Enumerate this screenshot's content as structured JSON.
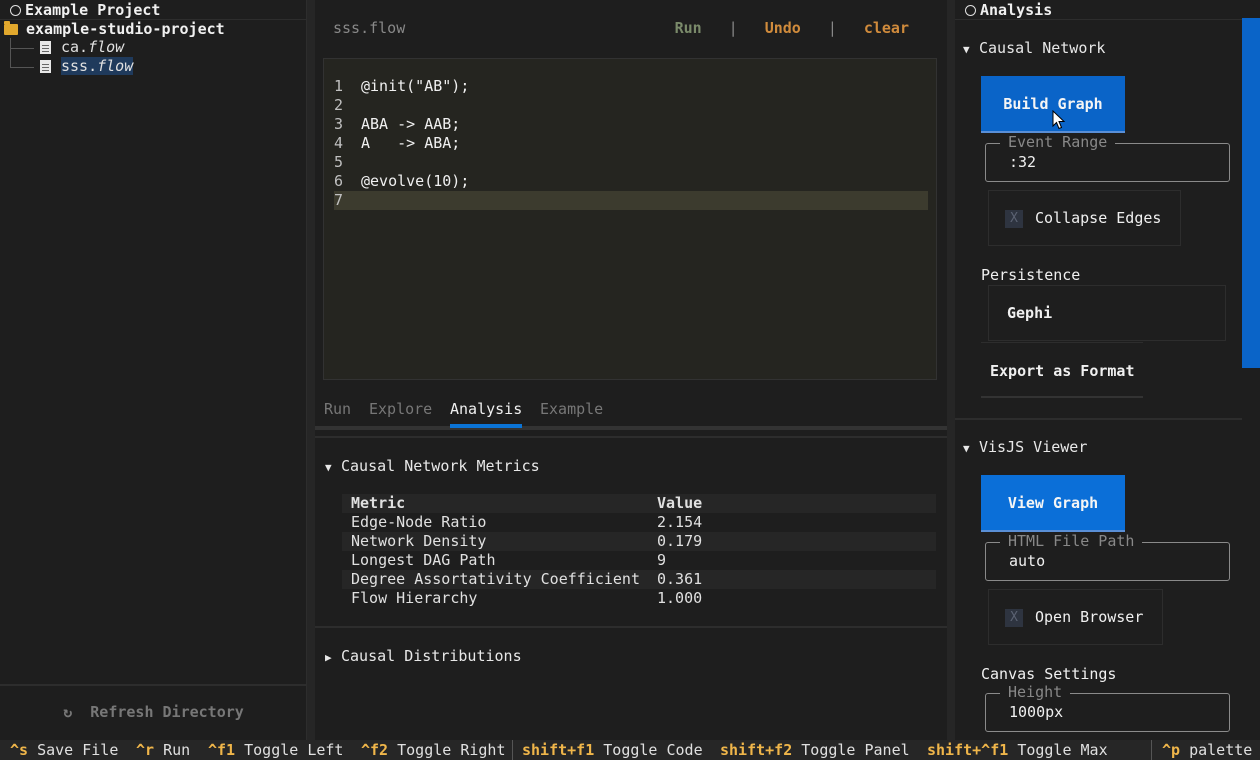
{
  "left_panel": {
    "title": "Example Project",
    "root_folder": "example-studio-project",
    "files": [
      {
        "name": "ca.",
        "ext": "flow"
      },
      {
        "name": "sss.",
        "ext": "flow"
      }
    ],
    "refresh_label": "Refresh Directory",
    "refresh_icon": "↻"
  },
  "editor": {
    "file_title": "sss.flow",
    "actions": {
      "run": "Run",
      "undo": "Undo",
      "clear": "clear",
      "sep": "|"
    },
    "lines": [
      {
        "n": "1",
        "text": "@init(\"AB\");"
      },
      {
        "n": "2",
        "text": ""
      },
      {
        "n": "3",
        "text": "ABA -> AAB;"
      },
      {
        "n": "4",
        "text": "A   -> ABA;"
      },
      {
        "n": "5",
        "text": ""
      },
      {
        "n": "6",
        "text": "@evolve(10);"
      },
      {
        "n": "7",
        "text": ""
      }
    ]
  },
  "bottom_tabs": [
    "Run",
    "Explore",
    "Analysis",
    "Example"
  ],
  "metrics": {
    "section_title": "Causal Network Metrics",
    "headers": [
      "Metric",
      "Value"
    ],
    "rows": [
      [
        "Edge-Node Ratio",
        "2.154"
      ],
      [
        "Network Density",
        "0.179"
      ],
      [
        "Longest DAG Path",
        "9"
      ],
      [
        "Degree Assortativity Coefficient",
        "0.361"
      ],
      [
        "Flow Hierarchy",
        "1.000"
      ]
    ],
    "distributions_title": "Causal Distributions"
  },
  "right_panel": {
    "title": "Analysis",
    "causal_network": {
      "title": "Causal Network",
      "build_button": "Build Graph",
      "event_range_legend": "Event Range",
      "event_range_value": ":32",
      "collapse_edges_label": "Collapse Edges",
      "collapse_checkbox": "X",
      "persistence_label": "Persistence",
      "persistence_value": "Gephi",
      "export_button": "Export as Format"
    },
    "visjs": {
      "title": "VisJS Viewer",
      "view_button": "View Graph",
      "html_path_legend": "HTML File Path",
      "html_path_value": "auto",
      "open_browser_label": "Open Browser",
      "open_browser_checkbox": "X",
      "canvas_settings_label": "Canvas Settings",
      "height_legend": "Height",
      "height_value": "1000px"
    }
  },
  "footer": [
    {
      "key": "^s",
      "desc": "Save File"
    },
    {
      "key": "^r",
      "desc": "Run"
    },
    {
      "key": "^f1",
      "desc": "Toggle Left"
    },
    {
      "key": "^f2",
      "desc": "Toggle Right"
    },
    {
      "key": "shift+f1",
      "desc": "Toggle Code"
    },
    {
      "key": "shift+f2",
      "desc": "Toggle Panel"
    },
    {
      "key": "shift+^f1",
      "desc": "Toggle Max"
    },
    {
      "key": "^p",
      "desc": "palette"
    }
  ],
  "colors": {
    "accent_blue": "#0a64c8",
    "key_orange": "#f0b64a",
    "action_orange": "#d08b3c",
    "folder": "#e2a82d"
  }
}
